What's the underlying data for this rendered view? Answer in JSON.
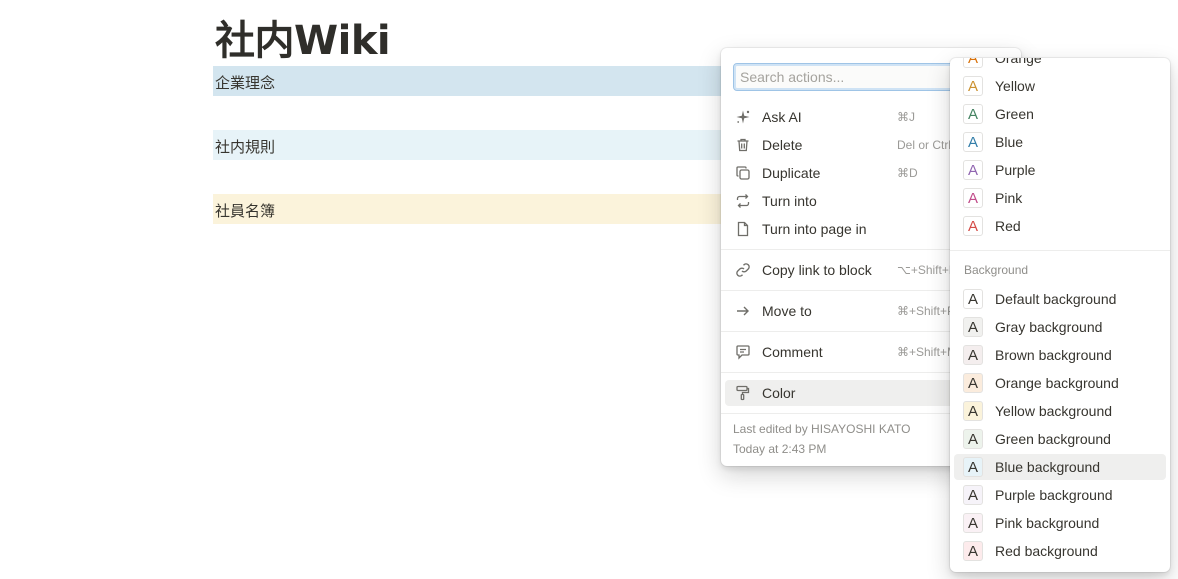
{
  "page": {
    "title": "社内Wiki"
  },
  "blocks": [
    {
      "text": "企業理念"
    },
    {
      "text": "社内規則"
    },
    {
      "text": "社員名簿"
    }
  ],
  "menu": {
    "search_placeholder": "Search actions...",
    "items": [
      {
        "label": "Ask AI",
        "shortcut": "⌘J",
        "icon": "sparkle-icon"
      },
      {
        "label": "Delete",
        "shortcut": "Del or Ctrl+D",
        "icon": "trash-icon"
      },
      {
        "label": "Duplicate",
        "shortcut": "⌘D",
        "icon": "duplicate-icon"
      },
      {
        "label": "Turn into",
        "shortcut": "",
        "icon": "turn-into-icon"
      },
      {
        "label": "Turn into page in",
        "shortcut": "",
        "icon": "page-icon"
      },
      {
        "label": "Copy link to block",
        "shortcut": "⌥+Shift+L",
        "icon": "link-icon"
      },
      {
        "label": "Move to",
        "shortcut": "⌘+Shift+P",
        "icon": "arrow-right-icon"
      },
      {
        "label": "Comment",
        "shortcut": "⌘+Shift+M",
        "icon": "comment-icon"
      },
      {
        "label": "Color",
        "shortcut": "",
        "icon": "paint-roller-icon"
      }
    ],
    "footer": {
      "edited_by": "Last edited by HISAYOSHI KATO",
      "time": "Today at 2:43 PM"
    }
  },
  "color_menu": {
    "text_colors": [
      {
        "label": "Orange",
        "color": "#d9730d"
      },
      {
        "label": "Yellow",
        "color": "#cb912f"
      },
      {
        "label": "Green",
        "color": "#448361"
      },
      {
        "label": "Blue",
        "color": "#337ea9"
      },
      {
        "label": "Purple",
        "color": "#9065b0"
      },
      {
        "label": "Pink",
        "color": "#c14c8a"
      },
      {
        "label": "Red",
        "color": "#d44c47"
      }
    ],
    "background_heading": "Background",
    "backgrounds": [
      {
        "label": "Default background",
        "bg": "#ffffff"
      },
      {
        "label": "Gray background",
        "bg": "#f1f1ef"
      },
      {
        "label": "Brown background",
        "bg": "#f4eeee"
      },
      {
        "label": "Orange background",
        "bg": "#fbecdd"
      },
      {
        "label": "Yellow background",
        "bg": "#fbf3db"
      },
      {
        "label": "Green background",
        "bg": "#edf3ec"
      },
      {
        "label": "Blue background",
        "bg": "#e7f3f8"
      },
      {
        "label": "Purple background",
        "bg": "#f6f3f9"
      },
      {
        "label": "Pink background",
        "bg": "#faf1f5"
      },
      {
        "label": "Red background",
        "bg": "#fdebec"
      }
    ],
    "swatch_glyph": "A"
  }
}
